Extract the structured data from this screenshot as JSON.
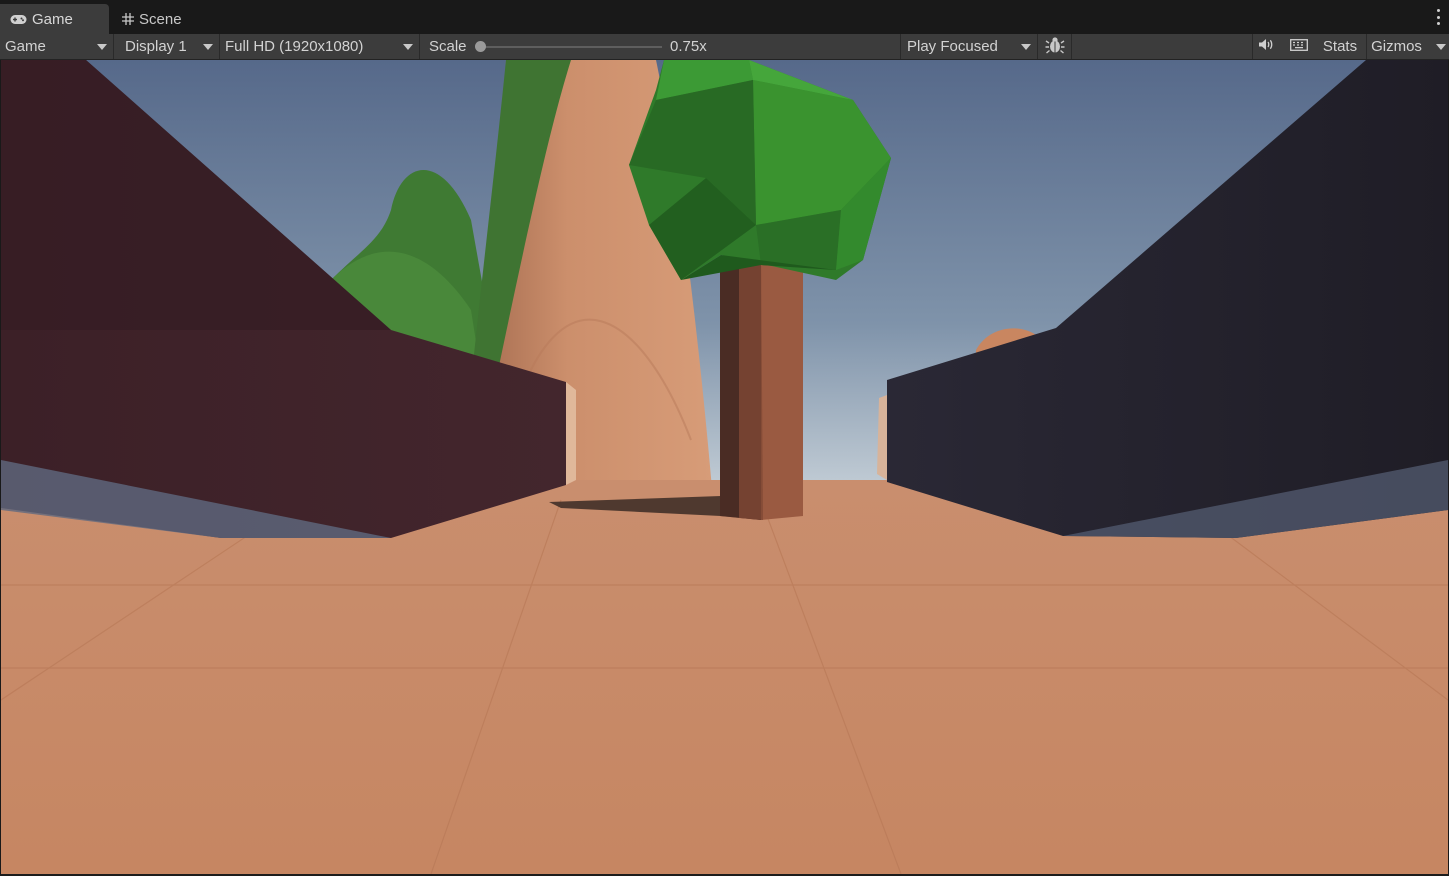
{
  "tabs": [
    {
      "label": "Game",
      "icon": "gamepad-icon",
      "active": true
    },
    {
      "label": "Scene",
      "icon": "grid-icon",
      "active": false
    }
  ],
  "toolbar": {
    "view_mode": "Game",
    "display": "Display 1",
    "resolution": "Full HD (1920x1080)",
    "scale_label": "Scale",
    "scale_value": "0.75x",
    "scale_fraction": 0.0,
    "play_mode": "Play Focused",
    "bug_icon": "bug-icon",
    "audio_icon": "speaker-icon",
    "keyboard_icon": "keyboard-icon",
    "stats_label": "Stats",
    "gizmos_label": "Gizmos"
  },
  "colors": {
    "panel": "#3c3c3c",
    "tab_bar": "#191919",
    "sky_top": "#5b7290",
    "ground": "#c98a66",
    "wall_left": "#3d2328",
    "wall_right": "#23222c",
    "tree_leaves": "#3c9a35",
    "tree_trunk": "#9a5a41"
  }
}
